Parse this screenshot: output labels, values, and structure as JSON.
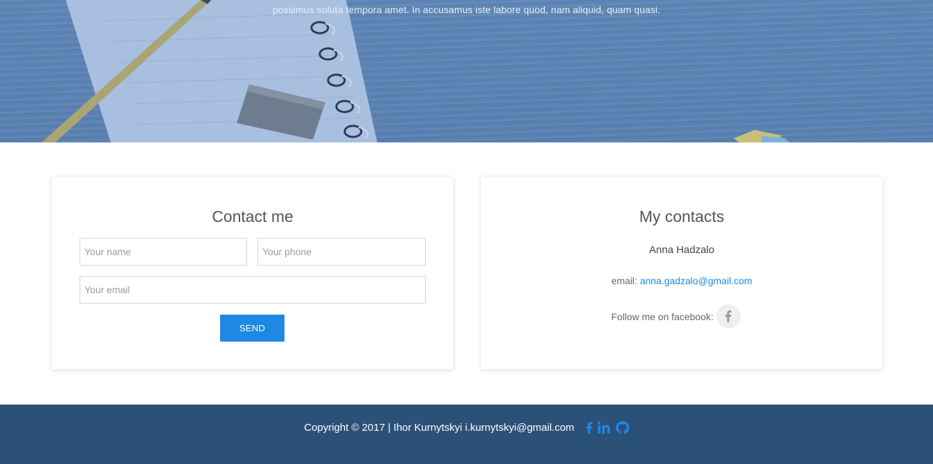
{
  "hero": {
    "text": "possimus soluta tempora amet. In accusamus iste labore quod, nam aliquid, quam quasi."
  },
  "contact_form": {
    "title": "Contact me",
    "name_placeholder": "Your name",
    "phone_placeholder": "Your phone",
    "email_placeholder": "Your email",
    "send_label": "SEND"
  },
  "my_contacts": {
    "title": "My contacts",
    "name": "Anna Hadzalo",
    "email_label": "email: ",
    "email_value": "anna.gadzalo@gmail.com",
    "follow_label": "Follow me on facebook:",
    "facebook_icon": "facebook-icon"
  },
  "footer": {
    "copyright": "Copyright © 2017 | Ihor Kurnytskyi i.kurnytskyi@gmail.com",
    "icons": [
      "facebook-icon",
      "linkedin-icon",
      "github-icon"
    ]
  },
  "colors": {
    "accent": "#1e88e5",
    "footer_bg": "#2b5178",
    "hero_tint": "#5f86b7"
  }
}
